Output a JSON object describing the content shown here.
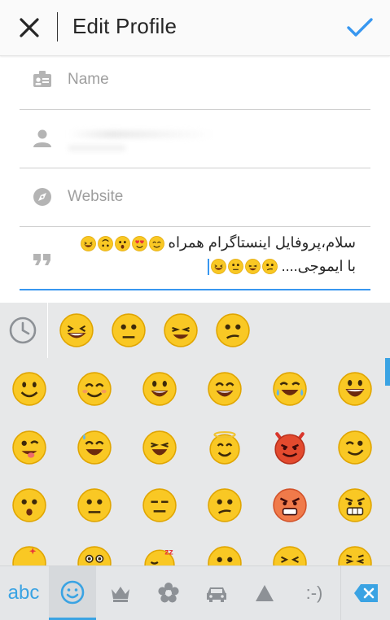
{
  "header": {
    "title": "Edit Profile"
  },
  "fields": {
    "name_placeholder": "Name",
    "website_placeholder": "Website",
    "bio_line1": "سلام،پروفایل اینستاگرام همراه",
    "bio_line2": "با ایموجی....",
    "bio_emojis_line1": [
      "grinning-eyes-closed",
      "blowing-kiss",
      "surprised",
      "upside-down",
      "grinning-squint"
    ],
    "bio_emojis_line2": [
      "confused",
      "laughing-tears",
      "neutral",
      "grinning-squint"
    ]
  },
  "keyboard": {
    "recent_emojis": [
      "grinning-squint",
      "neutral",
      "laughing",
      "confused"
    ],
    "tabs": {
      "abc": "abc",
      "emoticon": ":-)"
    }
  },
  "colors": {
    "accent": "#3897f0",
    "keyboard_accent": "#3aa3e3",
    "emoji_yellow": "#f9c824",
    "keyboard_bg": "#e7e8e9"
  }
}
